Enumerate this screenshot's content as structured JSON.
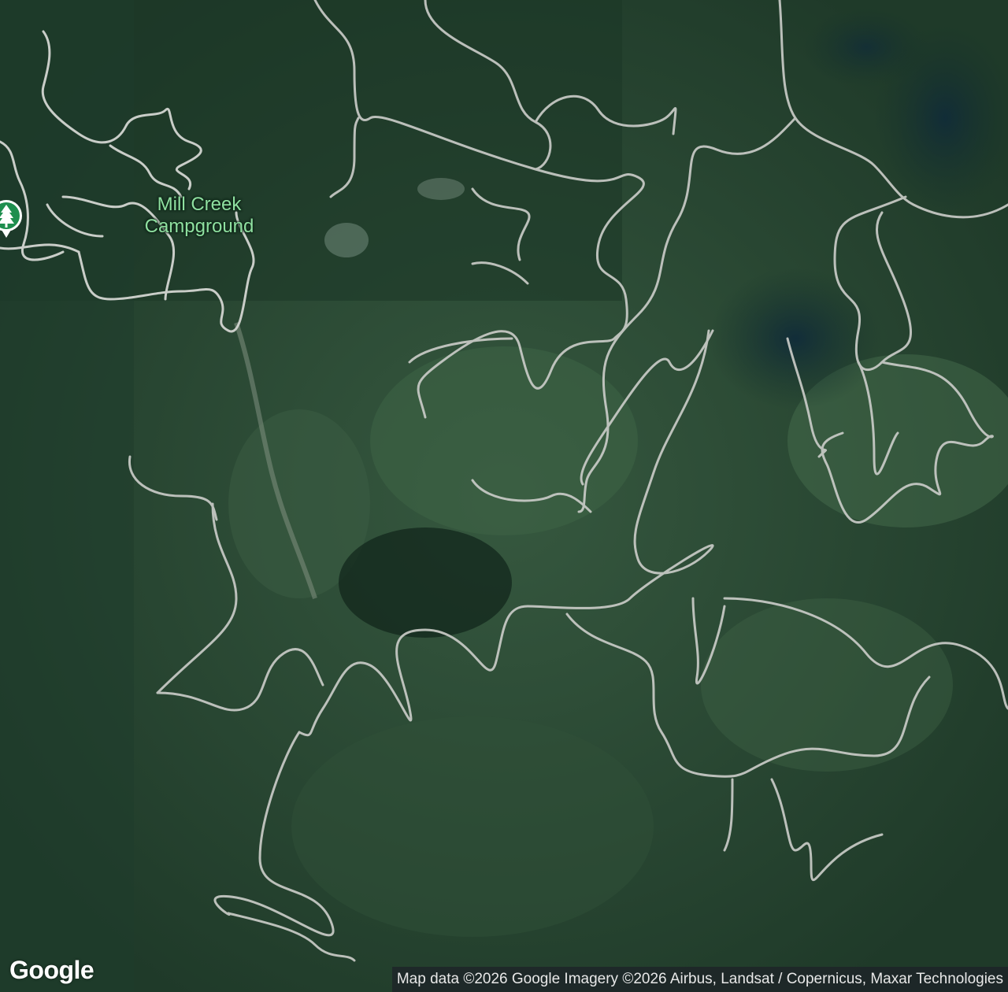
{
  "map": {
    "view": "satellite",
    "place_label": {
      "line1": "Mill Creek",
      "line2": "Campground"
    },
    "marker_icon": "campground-tree-icon",
    "colors": {
      "label_text": "#8fe0a0",
      "marker_fill": "#1e8e4e",
      "road": "#c9cbc7",
      "forest_dark": "#14291d",
      "forest_mid": "#2b4a36"
    }
  },
  "branding": {
    "logo": "Google"
  },
  "attribution": {
    "text": "Map data ©2026 Google Imagery ©2026 Airbus, Landsat / Copernicus, Maxar Technologies"
  }
}
